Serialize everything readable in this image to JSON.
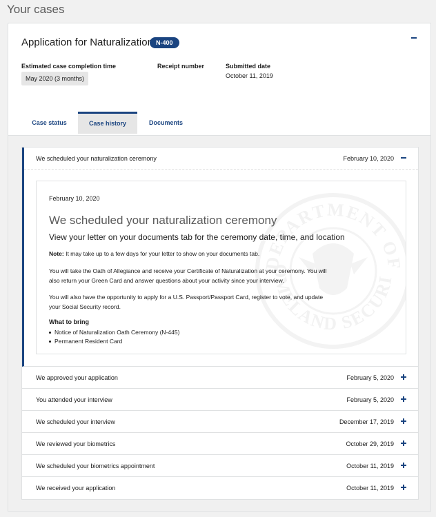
{
  "page": {
    "title": "Your cases"
  },
  "case": {
    "title": "Application for Naturalization",
    "form_badge": "N-400",
    "est_label": "Estimated case completion time",
    "est_value": "May 2020 (3 months)",
    "receipt_label": "Receipt number",
    "submitted_label": "Submitted date",
    "submitted_value": "October 11, 2019"
  },
  "tabs": [
    {
      "label": "Case status",
      "active": false
    },
    {
      "label": "Case history",
      "active": true
    },
    {
      "label": "Documents",
      "active": false
    }
  ],
  "history": {
    "expanded": {
      "title": "We scheduled your naturalization ceremony",
      "date": "February 10, 2020",
      "detail": {
        "date": "February 10, 2020",
        "heading": "We scheduled your naturalization ceremony",
        "subheading": "View your letter on your documents tab for the ceremony date, time, and location",
        "note_label": "Note:",
        "note_text": " It may take up to a few days for your letter to show on your documents tab.",
        "para1": "You will take the Oath of Allegiance and receive your Certificate of Naturalization at your ceremony. You will also return your Green Card and answer questions about your activity since your interview.",
        "para2": "You will also have the opportunity to apply for a U.S. Passport/Passport Card, register to vote, and update your Social Security record.",
        "bring_label": "What to bring",
        "bring_items": [
          "Notice of Naturalization Oath Ceremony (N-445)",
          "Permanent Resident Card"
        ],
        "seal_text": "DEPARTMENT OF HOMELAND SECURITY"
      }
    },
    "items": [
      {
        "title": "We approved your application",
        "date": "February 5, 2020"
      },
      {
        "title": "You attended your interview",
        "date": "February 5, 2020"
      },
      {
        "title": "We scheduled your interview",
        "date": "December 17, 2019"
      },
      {
        "title": "We reviewed your biometrics",
        "date": "October 29, 2019"
      },
      {
        "title": "We scheduled your biometrics appointment",
        "date": "October 11, 2019"
      },
      {
        "title": "We received your application",
        "date": "October 11, 2019"
      }
    ]
  },
  "colors": {
    "accent": "#1a4480",
    "panel_bg": "#f0f0f0",
    "chip_bg": "#e6e6e6"
  },
  "icons": {
    "collapse": "minus-icon",
    "expand": "plus-icon",
    "seal": "dhs-seal-watermark"
  }
}
